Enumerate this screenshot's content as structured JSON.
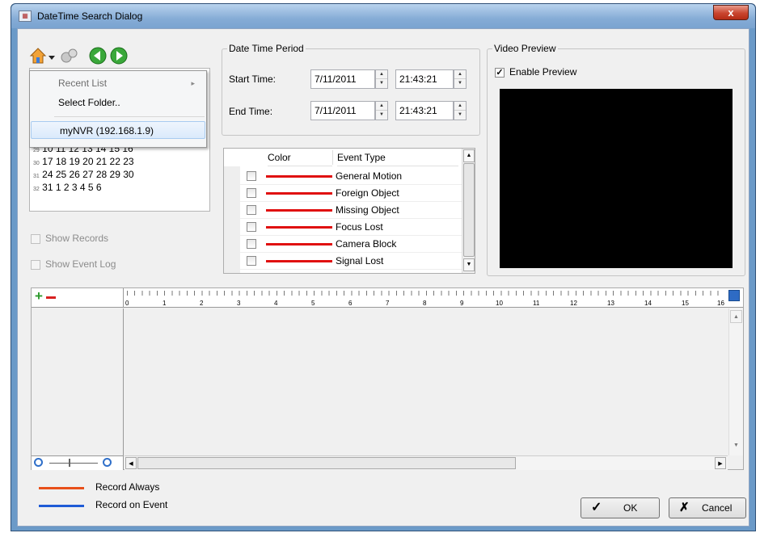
{
  "window": {
    "title": "DateTime Search Dialog",
    "close_glyph": "x"
  },
  "menu": {
    "items": [
      {
        "label": "Recent List",
        "submenu_arrow": "▸"
      },
      {
        "label": "Select Folder.."
      },
      {
        "label": "myNVR (192.168.1.9)"
      }
    ]
  },
  "calendar": {
    "rows": [
      {
        "week": "29",
        "days": "10 11 12 13 14 15 16"
      },
      {
        "week": "30",
        "days": "17 18 19 20 21 22 23"
      },
      {
        "week": "31",
        "days": "24 25 26 27 28 29 30"
      },
      {
        "week": "32",
        "days": "31  1  2  3  4  5  6"
      }
    ],
    "selected_day": "11"
  },
  "options": {
    "show_records": "Show Records",
    "show_event_log": "Show Event Log"
  },
  "period": {
    "group_title": "Date Time Period",
    "start_label": "Start Time:",
    "start_date": "7/11/2011",
    "start_time": "21:43:21",
    "end_label": "End Time:",
    "end_date": "7/11/2011",
    "end_time": "21:43:21"
  },
  "events": {
    "col_color": "Color",
    "col_type": "Event Type",
    "rows": [
      {
        "type": "General Motion",
        "color": "#e01010"
      },
      {
        "type": "Foreign Object",
        "color": "#e01010"
      },
      {
        "type": "Missing Object",
        "color": "#e01010"
      },
      {
        "type": "Focus Lost",
        "color": "#e01010"
      },
      {
        "type": "Camera Block",
        "color": "#e01010"
      },
      {
        "type": "Signal Lost",
        "color": "#e01010"
      }
    ]
  },
  "preview": {
    "group_title": "Video Preview",
    "enable_label": "Enable Preview",
    "enabled": true
  },
  "timeline": {
    "ticks": [
      "0",
      "1",
      "2",
      "3",
      "4",
      "5",
      "6",
      "7",
      "8",
      "9",
      "10",
      "11",
      "12",
      "13",
      "14",
      "15",
      "16"
    ]
  },
  "legend": [
    {
      "label": "Record Always",
      "color": "#e8501a"
    },
    {
      "label": "Record on Event",
      "color": "#1f5bd6"
    }
  ],
  "buttons": {
    "ok": "OK",
    "cancel": "Cancel"
  }
}
